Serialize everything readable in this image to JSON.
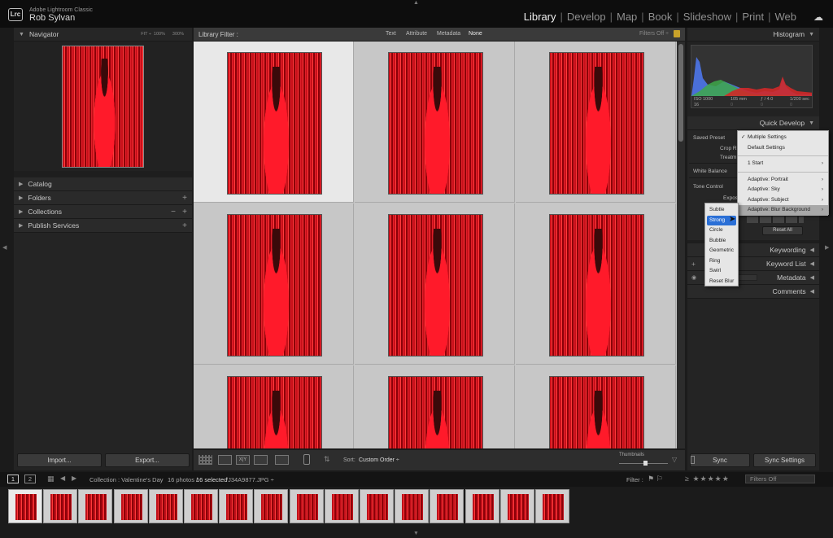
{
  "app": {
    "name": "Adobe Lightroom Classic",
    "logo": "Lrc",
    "user": "Rob Sylvan"
  },
  "modules": [
    "Library",
    "Develop",
    "Map",
    "Book",
    "Slideshow",
    "Print",
    "Web"
  ],
  "active_module": "Library",
  "left_panel": {
    "navigator": {
      "title": "Navigator",
      "zoom": [
        "FIT ÷",
        "100%",
        "300%"
      ]
    },
    "sections": [
      {
        "label": "Catalog"
      },
      {
        "label": "Folders"
      },
      {
        "label": "Collections"
      },
      {
        "label": "Publish Services"
      }
    ],
    "import_label": "Import...",
    "export_label": "Export..."
  },
  "filter_bar": {
    "title": "Library Filter :",
    "tabs": [
      "Text",
      "Attribute",
      "Metadata",
      "None"
    ],
    "filters": "Filters Off ÷"
  },
  "toolbar": {
    "sort_label": "Sort:",
    "sort_value": "Custom Order ÷",
    "thumbnails_label": "Thumbnails"
  },
  "right_panel": {
    "histogram_title": "Histogram",
    "exif": {
      "iso": "ISO 1000",
      "focal": "105 mm",
      "aperture": "ƒ / 4.0",
      "shutter": "1/200 sec"
    },
    "hist_counts": [
      "16",
      "0",
      "0",
      "0"
    ],
    "quick_develop_title": "Quick Develop",
    "saved_preset_label": "Saved Preset",
    "crop_label": "Crop R",
    "treatment_label": "Treatm",
    "white_balance_label": "White Balance",
    "tone_control_label": "Tone Control",
    "exposure_partial": "Expos",
    "vibrance_partial": "or",
    "reset_all": "Reset All",
    "keywording": "Keywording",
    "keyword_list": "Keyword List",
    "metadata": "Metadata",
    "comments": "Comments",
    "sync_label": "Sync",
    "sync_settings_label": "Sync Settings"
  },
  "preset_menu": {
    "items": [
      {
        "label": "Multiple Settings",
        "checked": true,
        "submenu": false
      },
      {
        "label": "Default Settings",
        "submenu": false
      },
      {
        "label": "1 Start",
        "submenu": true
      },
      {
        "label": "Adaptive: Portrait",
        "submenu": true
      },
      {
        "label": "Adaptive: Sky",
        "submenu": true
      },
      {
        "label": "Adaptive: Subject",
        "submenu": true
      },
      {
        "label": "Adaptive: Blur Background",
        "submenu": true,
        "highlighted": true
      }
    ]
  },
  "blur_submenu": {
    "items": [
      "Subtle",
      "Strong",
      "Circle",
      "Bubble",
      "Geometric",
      "Ring",
      "Swirl",
      "Reset Blur"
    ],
    "selected": "Strong"
  },
  "filmstrip_bar": {
    "screen1": "1",
    "screen2": "2",
    "collection": "Collection : Valentine's Day",
    "count": "16 photos /",
    "selected": "16 selected",
    "file": "/J34A9877.JPG ÷",
    "filter_label": "Filter :",
    "filters_off": "Filters Off"
  },
  "filmstrip": {
    "count": 16
  }
}
